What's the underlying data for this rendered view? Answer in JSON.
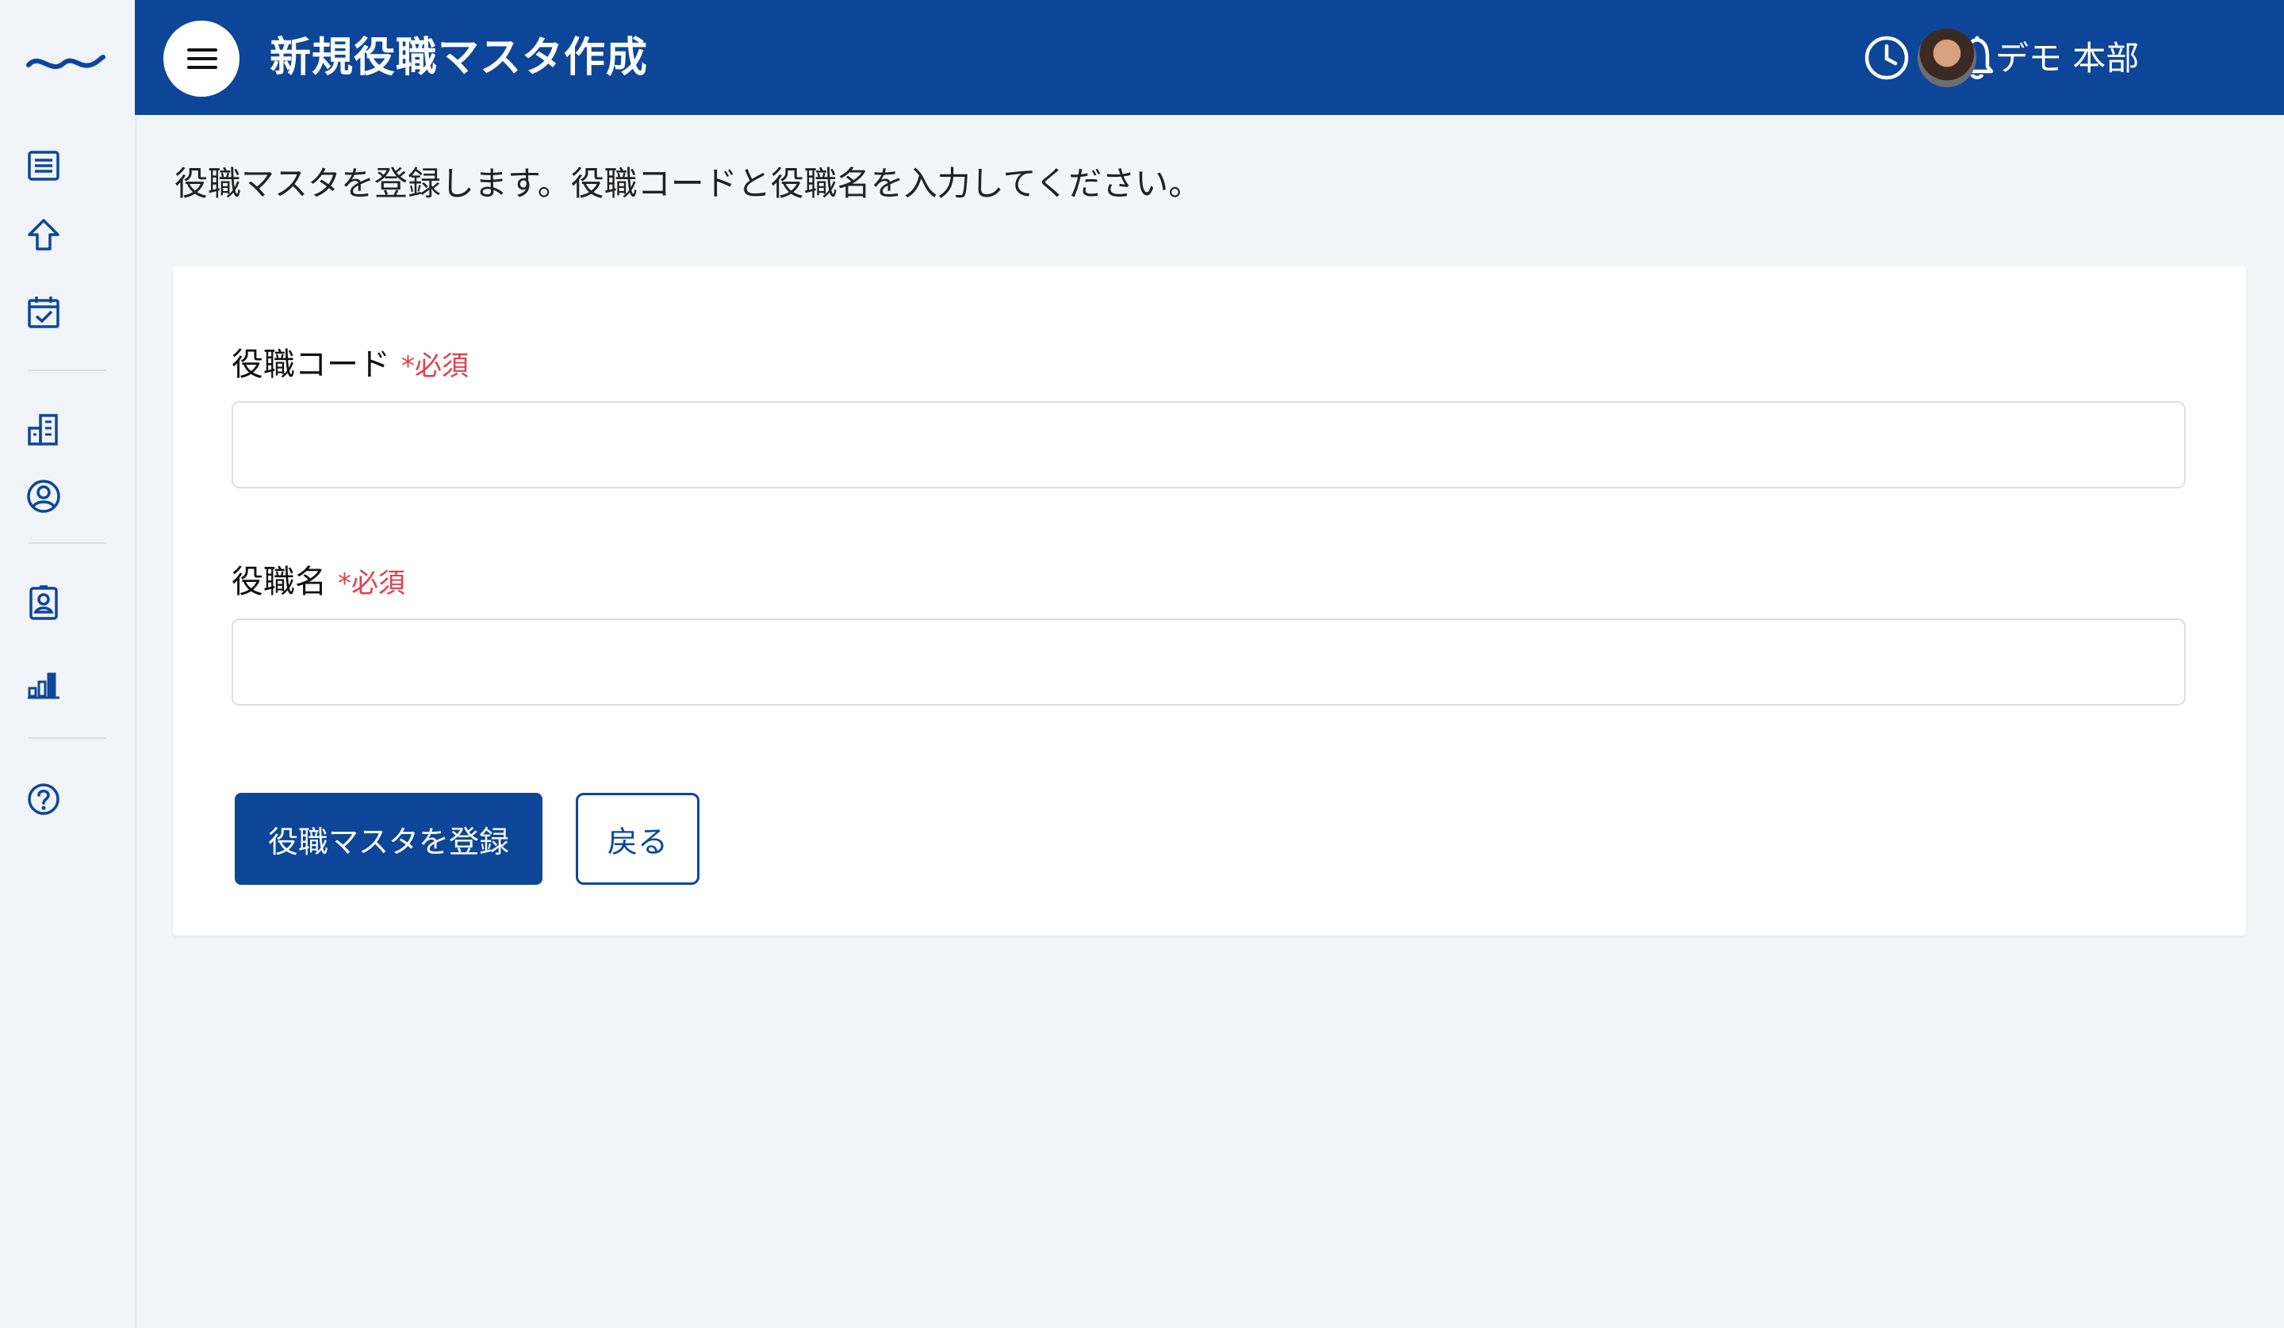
{
  "app": {
    "brand_color": "#0d4699",
    "required_color": "#e0414c"
  },
  "sidebar": {
    "logo": "wave-logo",
    "items": [
      {
        "icon": "list-icon"
      },
      {
        "icon": "home-arrow-icon"
      },
      {
        "icon": "calendar-check-icon"
      },
      {
        "icon": "building-icon"
      },
      {
        "icon": "user-circle-icon"
      },
      {
        "icon": "id-card-icon"
      },
      {
        "icon": "bar-chart-icon"
      },
      {
        "icon": "help-icon"
      }
    ]
  },
  "header": {
    "title": "新規役職マスタ作成",
    "menu_icon": "hamburger-icon",
    "history_icon": "clock-icon",
    "notification_icon": "bell-icon",
    "user_name": "デモ 本部"
  },
  "main": {
    "intro": "役職マスタを登録します。役職コードと役職名を入力してください。",
    "form": {
      "code_label": "役職コード",
      "code_required": "*必須",
      "code_value": "",
      "name_label": "役職名",
      "name_required": "*必須",
      "name_value": "",
      "submit_label": "役職マスタを登録",
      "back_label": "戻る"
    }
  }
}
